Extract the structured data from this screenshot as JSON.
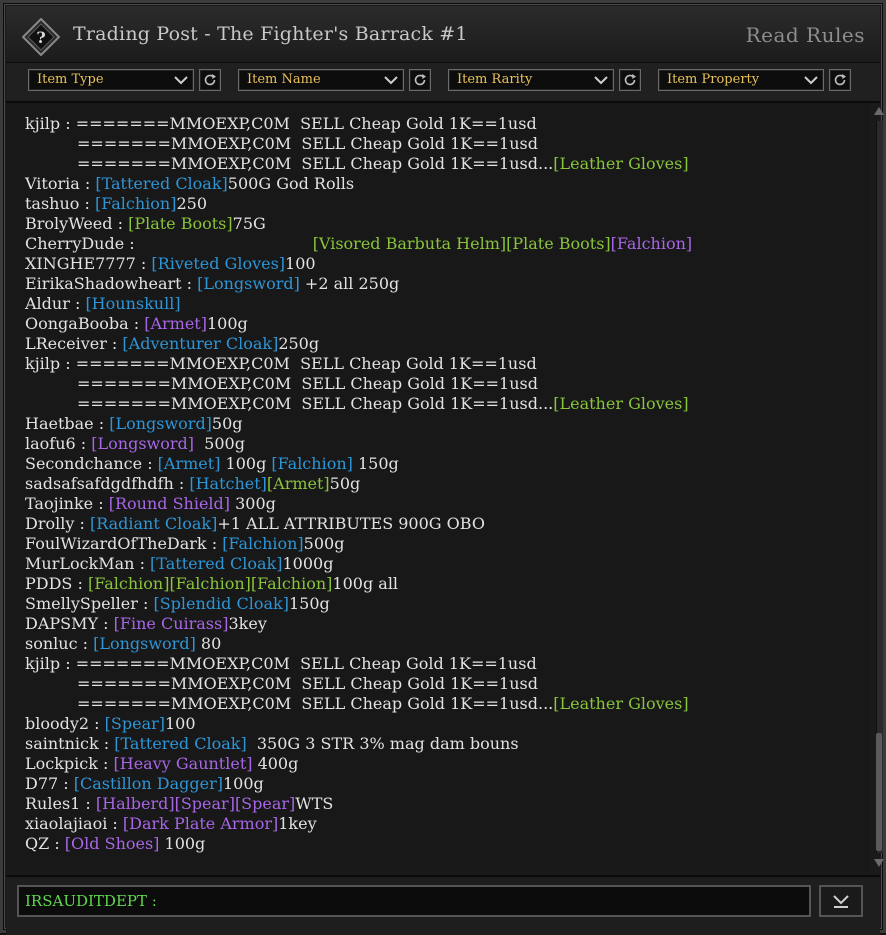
{
  "window": {
    "title": "Trading Post - The Fighter's Barrack #1",
    "read_rules": "Read Rules"
  },
  "filters": [
    {
      "label": "Item Type"
    },
    {
      "label": "Item Name"
    },
    {
      "label": "Item Rarity"
    },
    {
      "label": "Item Property"
    }
  ],
  "colors": {
    "filter_label": "#e8c15a",
    "rarity_common": "#89c43a",
    "rarity_uncommon": "#2e95d6",
    "rarity_rare": "#a866e6",
    "chat_text": "#e2e2e2",
    "own_name": "#5fd84e"
  },
  "icons": {
    "help": "question-diamond-icon",
    "dropdown": "chevron-down-icon",
    "refresh": "refresh-icon",
    "send": "chevron-down-bar-icon"
  },
  "chat": [
    {
      "name": "kjilp",
      "parts": [
        {
          "t": "=======MMOEXP,C0M  SELL Cheap Gold 1K==1usd"
        }
      ]
    },
    {
      "cont": true,
      "parts": [
        {
          "t": "=======MMOEXP,C0M  SELL Cheap Gold 1K==1usd"
        }
      ]
    },
    {
      "cont": true,
      "parts": [
        {
          "t": "=======MMOEXP,C0M  SELL Cheap Gold 1K==1usd..."
        },
        {
          "i": "[Leather Gloves]",
          "r": "common"
        }
      ]
    },
    {
      "name": "Vitoria",
      "parts": [
        {
          "i": "[Tattered Cloak]",
          "r": "uncommon"
        },
        {
          "t": "500G God Rolls"
        }
      ]
    },
    {
      "name": "tashuo",
      "parts": [
        {
          "i": "[Falchion]",
          "r": "uncommon"
        },
        {
          "t": "250"
        }
      ]
    },
    {
      "name": "BrolyWeed",
      "parts": [
        {
          "i": "[Plate Boots]",
          "r": "common"
        },
        {
          "t": "75G"
        }
      ]
    },
    {
      "name": "CherryDude",
      "parts": [
        {
          "t": "                                  "
        },
        {
          "i": "[Visored Barbuta Helm]",
          "r": "common"
        },
        {
          "i": "[Plate Boots]",
          "r": "common"
        },
        {
          "i": "[Falchion]",
          "r": "rare"
        }
      ]
    },
    {
      "name": "XINGHE7777",
      "parts": [
        {
          "i": "[Riveted Gloves]",
          "r": "uncommon"
        },
        {
          "t": "100"
        }
      ]
    },
    {
      "name": "EirikaShadowheart",
      "parts": [
        {
          "i": "[Longsword]",
          "r": "uncommon"
        },
        {
          "t": " +2 all 250g"
        }
      ]
    },
    {
      "name": "Aldur",
      "parts": [
        {
          "i": "[Hounskull]",
          "r": "uncommon"
        }
      ]
    },
    {
      "name": "OongaBooba",
      "parts": [
        {
          "i": "[Armet]",
          "r": "rare"
        },
        {
          "t": "100g"
        }
      ]
    },
    {
      "name": "LReceiver",
      "parts": [
        {
          "i": "[Adventurer Cloak]",
          "r": "uncommon"
        },
        {
          "t": "250g"
        }
      ]
    },
    {
      "name": "kjilp",
      "parts": [
        {
          "t": "=======MMOEXP,C0M  SELL Cheap Gold 1K==1usd"
        }
      ]
    },
    {
      "cont": true,
      "parts": [
        {
          "t": "=======MMOEXP,C0M  SELL Cheap Gold 1K==1usd"
        }
      ]
    },
    {
      "cont": true,
      "parts": [
        {
          "t": "=======MMOEXP,C0M  SELL Cheap Gold 1K==1usd..."
        },
        {
          "i": "[Leather Gloves]",
          "r": "common"
        }
      ]
    },
    {
      "name": "Haetbae",
      "parts": [
        {
          "i": "[Longsword]",
          "r": "uncommon"
        },
        {
          "t": "50g"
        }
      ]
    },
    {
      "name": "laofu6",
      "parts": [
        {
          "i": "[Longsword]",
          "r": "rare"
        },
        {
          "t": "  500g"
        }
      ]
    },
    {
      "name": "Secondchance",
      "parts": [
        {
          "i": "[Armet]",
          "r": "uncommon"
        },
        {
          "t": " 100g "
        },
        {
          "i": "[Falchion]",
          "r": "uncommon"
        },
        {
          "t": " 150g"
        }
      ]
    },
    {
      "name": "sadsafsafdgdfhdfh",
      "parts": [
        {
          "i": "[Hatchet]",
          "r": "uncommon"
        },
        {
          "i": "[Armet]",
          "r": "common"
        },
        {
          "t": "50g"
        }
      ]
    },
    {
      "name": "Taojinke",
      "parts": [
        {
          "i": "[Round Shield]",
          "r": "rare"
        },
        {
          "t": " 300g"
        }
      ]
    },
    {
      "name": "Drolly",
      "parts": [
        {
          "i": "[Radiant Cloak]",
          "r": "uncommon"
        },
        {
          "t": "+1 ALL ATTRIBUTES 900G OBO"
        }
      ]
    },
    {
      "name": "FoulWizardOfTheDark",
      "parts": [
        {
          "i": "[Falchion]",
          "r": "uncommon"
        },
        {
          "t": "500g"
        }
      ]
    },
    {
      "name": "MurLockMan",
      "parts": [
        {
          "i": "[Tattered Cloak]",
          "r": "uncommon"
        },
        {
          "t": "1000g"
        }
      ]
    },
    {
      "name": "PDDS",
      "parts": [
        {
          "i": "[Falchion]",
          "r": "common"
        },
        {
          "i": "[Falchion]",
          "r": "common"
        },
        {
          "i": "[Falchion]",
          "r": "common"
        },
        {
          "t": "100g all"
        }
      ]
    },
    {
      "name": "SmellySpeller",
      "parts": [
        {
          "i": "[Splendid Cloak]",
          "r": "uncommon"
        },
        {
          "t": "150g"
        }
      ]
    },
    {
      "name": "DAPSMY",
      "parts": [
        {
          "i": "[Fine Cuirass]",
          "r": "rare"
        },
        {
          "t": "3key"
        }
      ]
    },
    {
      "name": "sonluc",
      "parts": [
        {
          "i": "[Longsword]",
          "r": "uncommon"
        },
        {
          "t": " 80"
        }
      ]
    },
    {
      "name": "kjilp",
      "parts": [
        {
          "t": "=======MMOEXP,C0M  SELL Cheap Gold 1K==1usd"
        }
      ]
    },
    {
      "cont": true,
      "parts": [
        {
          "t": "=======MMOEXP,C0M  SELL Cheap Gold 1K==1usd"
        }
      ]
    },
    {
      "cont": true,
      "parts": [
        {
          "t": "=======MMOEXP,C0M  SELL Cheap Gold 1K==1usd..."
        },
        {
          "i": "[Leather Gloves]",
          "r": "common"
        }
      ]
    },
    {
      "name": "bloody2",
      "parts": [
        {
          "i": "[Spear]",
          "r": "uncommon"
        },
        {
          "t": "100"
        }
      ]
    },
    {
      "name": "saintnick",
      "parts": [
        {
          "i": "[Tattered Cloak]",
          "r": "uncommon"
        },
        {
          "t": "  350G 3 STR 3% mag dam bouns"
        }
      ]
    },
    {
      "name": "Lockpick",
      "parts": [
        {
          "i": "[Heavy Gauntlet]",
          "r": "rare"
        },
        {
          "t": " 400g"
        }
      ]
    },
    {
      "name": "D77",
      "parts": [
        {
          "i": "[Castillon Dagger]",
          "r": "uncommon"
        },
        {
          "t": "100g"
        }
      ]
    },
    {
      "name": "Rules1",
      "parts": [
        {
          "i": "[Halberd]",
          "r": "rare"
        },
        {
          "i": "[Spear]",
          "r": "rare"
        },
        {
          "i": "[Spear]",
          "r": "rare"
        },
        {
          "t": "WTS"
        }
      ]
    },
    {
      "name": "xiaolajiaoi",
      "parts": [
        {
          "i": "[Dark Plate Armor]",
          "r": "rare"
        },
        {
          "t": "1key"
        }
      ]
    },
    {
      "name": "QZ",
      "parts": [
        {
          "i": "[Old Shoes]",
          "r": "rare"
        },
        {
          "t": " 100g"
        }
      ]
    }
  ],
  "input": {
    "name": "IRSAUDITDEPT :",
    "value": ""
  }
}
